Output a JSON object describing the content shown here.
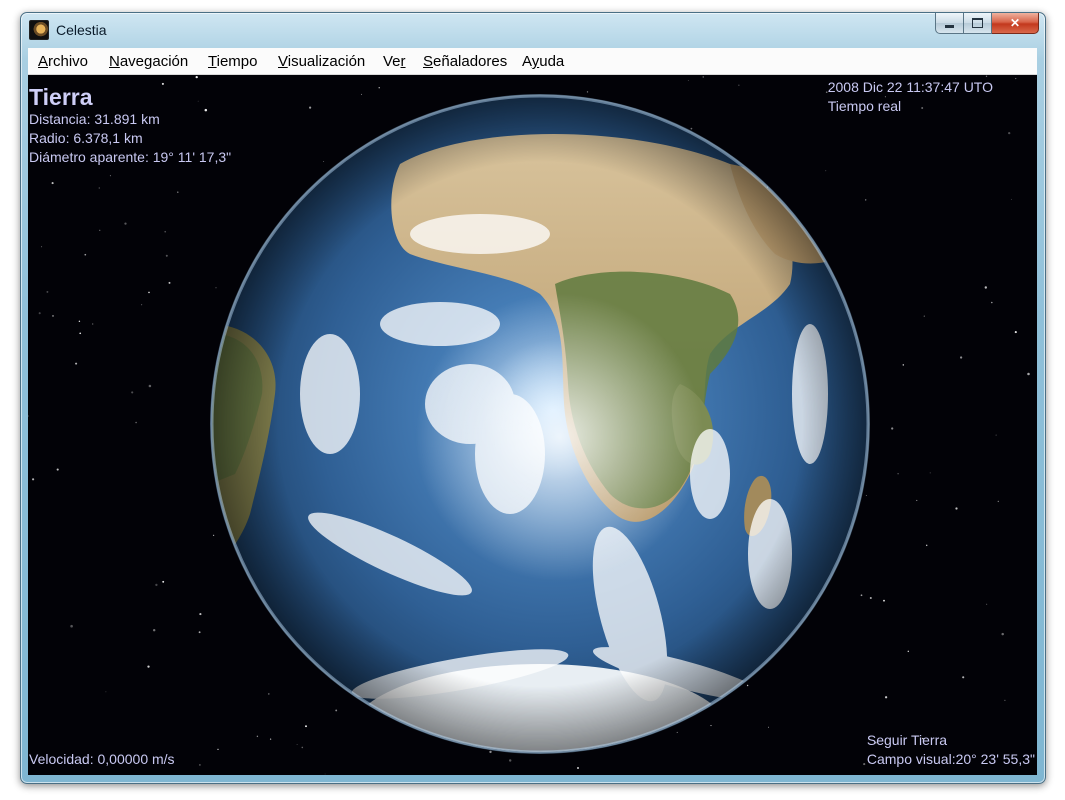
{
  "window": {
    "title": "Celestia",
    "controls": {
      "minimize": "minimize-icon",
      "maximize": "maximize-icon",
      "close": "close-icon"
    }
  },
  "menu": {
    "items": [
      {
        "label": "Archivo",
        "mnemonic": "A"
      },
      {
        "label": "Navegación",
        "mnemonic": "N"
      },
      {
        "label": "Tiempo",
        "mnemonic": "T"
      },
      {
        "label": "Visualización",
        "mnemonic": "V"
      },
      {
        "label": "Ver",
        "mnemonic": "r"
      },
      {
        "label": "Señaladores",
        "mnemonic": "S"
      },
      {
        "label": "Ayuda",
        "mnemonic": "y"
      }
    ]
  },
  "object_info": {
    "name": "Tierra",
    "distance": "Distancia: 31.891 km",
    "radius": "Radio: 6.378,1 km",
    "apparent_diameter": "Diámetro aparente: 19° 11' 17,3\""
  },
  "time_info": {
    "datetime": "2008 Dic 22 11:37:47 UTO",
    "mode": "Tiempo real"
  },
  "speed": "Velocidad: 0,00000 m/s",
  "camera": {
    "follow": "Seguir Tierra",
    "fov": "Campo visual:20° 23' 55,3\""
  },
  "colors": {
    "hud_text": "#c9c9f2",
    "space": "#020207",
    "ocean": "#2f5f94",
    "land": "#6e7a45",
    "desert": "#c6aa7a",
    "ice": "#e8eef3"
  }
}
